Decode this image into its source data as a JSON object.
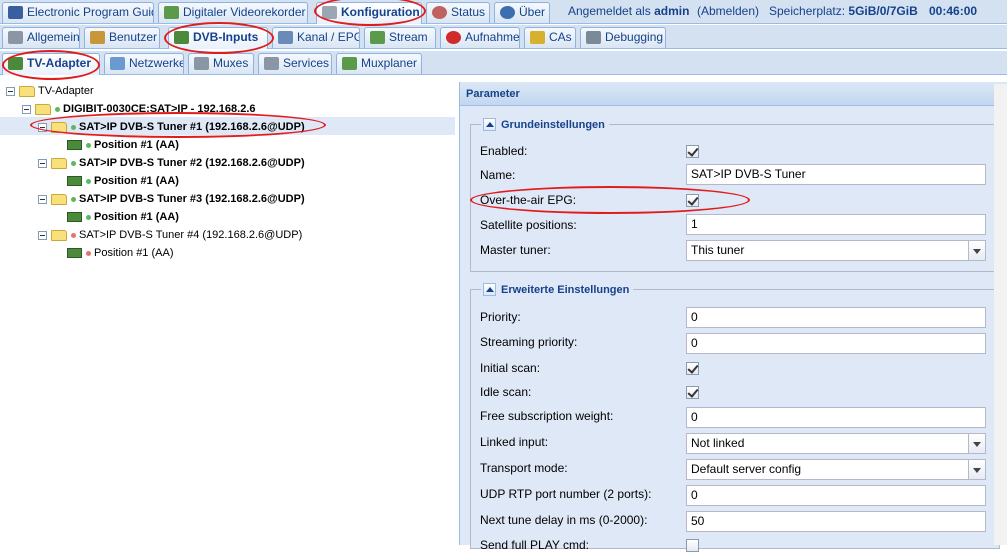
{
  "header": {
    "tabs": [
      {
        "label": "Electronic Program Guide",
        "icon": "epg-icon",
        "active": false
      },
      {
        "label": "Digitaler Videorekorder",
        "icon": "download-icon",
        "active": false
      },
      {
        "label": "Konfiguration",
        "icon": "wrench-icon",
        "active": true
      },
      {
        "label": "Status",
        "icon": "eye-icon",
        "active": false
      },
      {
        "label": "Über",
        "icon": "info-icon",
        "active": false
      }
    ],
    "logged_in_label": "Angemeldet als",
    "username": "admin",
    "logout_label": "(Abmelden)",
    "storage_label": "Speicherplatz:",
    "storage_value": "5GiB/0/7GiB",
    "clock": "00:46:00"
  },
  "config_tabs": [
    {
      "label": "Allgemein",
      "icon": "tools-icon",
      "active": false
    },
    {
      "label": "Benutzer",
      "icon": "user-icon",
      "active": false
    },
    {
      "label": "DVB-Inputs",
      "icon": "dvb-card-icon",
      "active": true
    },
    {
      "label": "Kanal / EPG",
      "icon": "tv-icon",
      "active": false
    },
    {
      "label": "Stream",
      "icon": "stream-icon",
      "active": false
    },
    {
      "label": "Aufnahme",
      "icon": "rec-icon",
      "active": false
    },
    {
      "label": "CAs",
      "icon": "key-icon",
      "active": false
    },
    {
      "label": "Debugging",
      "icon": "bug-icon",
      "active": false
    }
  ],
  "dvb_tabs": [
    {
      "label": "TV-Adapter",
      "icon": "adapter-icon",
      "active": true
    },
    {
      "label": "Netzwerke",
      "icon": "network-icon",
      "active": false
    },
    {
      "label": "Muxes",
      "icon": "mux-icon",
      "active": false
    },
    {
      "label": "Services",
      "icon": "services-icon",
      "active": false
    },
    {
      "label": "Muxplaner",
      "icon": "planner-icon",
      "active": false
    }
  ],
  "tree": {
    "root": "TV-Adapter",
    "device": "DIGIBIT-0030CE:SAT>IP - 192.168.2.6",
    "tuners": [
      {
        "label": "SAT>IP DVB-S Tuner #1 (192.168.2.6@UDP)",
        "position": "Position #1 (AA)",
        "enabled": true
      },
      {
        "label": "SAT>IP DVB-S Tuner #2 (192.168.2.6@UDP)",
        "position": "Position #1 (AA)",
        "enabled": true
      },
      {
        "label": "SAT>IP DVB-S Tuner #3 (192.168.2.6@UDP)",
        "position": "Position #1 (AA)",
        "enabled": true
      },
      {
        "label": "SAT>IP DVB-S Tuner #4 (192.168.2.6@UDP)",
        "position": "Position #1 (AA)",
        "enabled": false
      }
    ]
  },
  "params": {
    "title": "Parameter",
    "basic": {
      "legend": "Grundeinstellungen",
      "enabled_label": "Enabled:",
      "enabled": true,
      "name_label": "Name:",
      "name_value": "SAT>IP DVB-S Tuner",
      "ota_epg_label": "Over-the-air EPG:",
      "ota_epg": true,
      "sat_positions_label": "Satellite positions:",
      "sat_positions_value": "1",
      "master_tuner_label": "Master tuner:",
      "master_tuner_value": "This tuner"
    },
    "advanced": {
      "legend": "Erweiterte Einstellungen",
      "priority_label": "Priority:",
      "priority_value": "0",
      "streaming_priority_label": "Streaming priority:",
      "streaming_priority_value": "0",
      "initial_scan_label": "Initial scan:",
      "initial_scan": true,
      "idle_scan_label": "Idle scan:",
      "idle_scan": true,
      "free_sub_weight_label": "Free subscription weight:",
      "free_sub_weight_value": "0",
      "linked_input_label": "Linked input:",
      "linked_input_value": "Not linked",
      "transport_mode_label": "Transport mode:",
      "transport_mode_value": "Default server config",
      "udp_rtp_label": "UDP RTP port number (2 ports):",
      "udp_rtp_value": "0",
      "next_tune_label": "Next tune delay in ms (0-2000):",
      "next_tune_value": "50",
      "send_full_play_label": "Send full PLAY cmd:",
      "send_full_play": false
    }
  },
  "colors": {
    "accent": "#15428b",
    "panel_bg": "#dfe8f6",
    "highlight_ellipse": "#e21b1b",
    "status_ok": "#5cb85c",
    "status_off": "#e57373"
  }
}
